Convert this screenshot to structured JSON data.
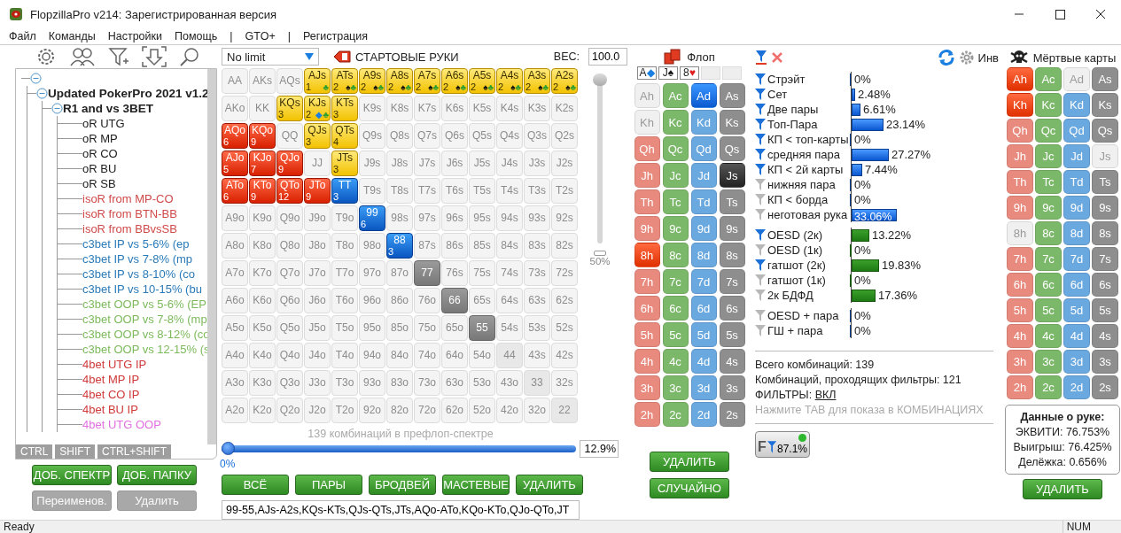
{
  "window": {
    "title": "FlopzillaPro v214: Зарегистрированная версия"
  },
  "menu": [
    "Файл",
    "Команды",
    "Настройки",
    "Помощь",
    "|",
    "GTO+",
    "|",
    "Регистрация"
  ],
  "tree": {
    "expanded": true,
    "children": [
      {
        "label": "Updated PokerPro 2021 v1.2",
        "expanded": true,
        "children": [
          {
            "label": "R1 and vs 3BET",
            "expanded": true,
            "children": [
              {
                "label": "oR UTG",
                "color": "#202020"
              },
              {
                "label": "oR MP",
                "color": "#202020"
              },
              {
                "label": "oR CO",
                "color": "#202020"
              },
              {
                "label": "oR BU",
                "color": "#202020"
              },
              {
                "label": "oR SB",
                "color": "#202020"
              },
              {
                "label": "isoR from MP-CO",
                "color": "#d04a4a"
              },
              {
                "label": "isoR from BTN-BB",
                "color": "#d04a4a"
              },
              {
                "label": "isoR from BBvsSB",
                "color": "#d04a4a"
              },
              {
                "label": "c3bet IP vs 5-6% (ep",
                "color": "#2a7ab8"
              },
              {
                "label": "c3bet IP vs 7-8% (mp",
                "color": "#2a7ab8"
              },
              {
                "label": "c3bet IP vs 8-10% (co",
                "color": "#2a7ab8"
              },
              {
                "label": "c3bet IP vs 10-15% (bu",
                "color": "#2a7ab8"
              },
              {
                "label": "c3bet OOP vs 5-6% (EP",
                "color": "#7cba5c"
              },
              {
                "label": "c3bet OOP vs 7-8% (mp",
                "color": "#7cba5c"
              },
              {
                "label": "c3bet OOP vs 8-12% (co",
                "color": "#7cba5c"
              },
              {
                "label": "c3bet OOP vs 12-15% (s",
                "color": "#7cba5c"
              },
              {
                "label": "4bet UTG IP",
                "color": "#d03a3a"
              },
              {
                "label": "4bet MP IP",
                "color": "#d03a3a"
              },
              {
                "label": "4bet CO IP",
                "color": "#d03a3a"
              },
              {
                "label": "4bet BU IP",
                "color": "#d03a3a"
              },
              {
                "label": "4bet UTG OOP",
                "color": "#e070e0"
              }
            ]
          }
        ]
      }
    ]
  },
  "modifier_keys": [
    "CTRL",
    "SHIFT",
    "CTRL+SHIFT"
  ],
  "left_buttons": [
    {
      "label": "ДОБ. СПЕКТР",
      "disabled": false
    },
    {
      "label": "ДОБ. ПАПКУ",
      "disabled": false
    },
    {
      "label": "Переименов.",
      "disabled": true
    },
    {
      "label": "Удалить",
      "disabled": true
    }
  ],
  "range": {
    "game_type": "No limit",
    "title": "СТАРТОВЫЕ РУКИ",
    "weight_label": "ВЕС:",
    "weight": "100.0",
    "matrix": [
      [
        {
          "label": "AA",
          "kind": "empty"
        },
        {
          "label": "AKs",
          "kind": "empty"
        },
        {
          "label": "AQs",
          "kind": "empty"
        },
        {
          "label": "AJs",
          "kind": "suited",
          "count": "1",
          "suits": [
            {
              "symbol": "♣",
              "color": "#2e9e2e"
            }
          ]
        },
        {
          "label": "ATs",
          "kind": "suited",
          "count": "2",
          "suits": [
            {
              "symbol": "♠",
              "color": "#111111"
            },
            {
              "symbol": "♣",
              "color": "#2e9e2e"
            }
          ]
        },
        {
          "label": "A9s",
          "kind": "suited",
          "count": "2",
          "suits": [
            {
              "symbol": "♠",
              "color": "#111111"
            },
            {
              "symbol": "♣",
              "color": "#2e9e2e"
            }
          ]
        },
        {
          "label": "A8s",
          "kind": "suited",
          "count": "2",
          "suits": [
            {
              "symbol": "♠",
              "color": "#111111"
            },
            {
              "symbol": "♣",
              "color": "#2e9e2e"
            }
          ]
        },
        {
          "label": "A7s",
          "kind": "suited",
          "count": "2",
          "suits": [
            {
              "symbol": "♠",
              "color": "#111111"
            },
            {
              "symbol": "♣",
              "color": "#2e9e2e"
            }
          ]
        },
        {
          "label": "A6s",
          "kind": "suited",
          "count": "2",
          "suits": [
            {
              "symbol": "♠",
              "color": "#111111"
            },
            {
              "symbol": "♣",
              "color": "#2e9e2e"
            }
          ]
        },
        {
          "label": "A5s",
          "kind": "suited",
          "count": "2",
          "suits": [
            {
              "symbol": "♠",
              "color": "#111111"
            },
            {
              "symbol": "♣",
              "color": "#2e9e2e"
            }
          ]
        },
        {
          "label": "A4s",
          "kind": "suited",
          "count": "2",
          "suits": [
            {
              "symbol": "♠",
              "color": "#111111"
            },
            {
              "symbol": "♣",
              "color": "#2e9e2e"
            }
          ]
        },
        {
          "label": "A3s",
          "kind": "suited",
          "count": "2",
          "suits": [
            {
              "symbol": "♠",
              "color": "#111111"
            },
            {
              "symbol": "♣",
              "color": "#2e9e2e"
            }
          ]
        },
        {
          "label": "A2s",
          "kind": "suited",
          "count": "2",
          "suits": [
            {
              "symbol": "♠",
              "color": "#111111"
            },
            {
              "symbol": "♣",
              "color": "#2e9e2e"
            }
          ]
        }
      ],
      [
        {
          "label": "AKo",
          "kind": "empty"
        },
        {
          "label": "KK",
          "kind": "empty"
        },
        {
          "label": "KQs",
          "kind": "suited",
          "count": "3"
        },
        {
          "label": "KJs",
          "kind": "suited",
          "count": "2",
          "suits": [
            {
              "symbol": "◆",
              "color": "#1a7fe0"
            },
            {
              "symbol": "♣",
              "color": "#2e9e2e"
            }
          ]
        },
        {
          "label": "KTs",
          "kind": "suited",
          "count": "3"
        },
        {
          "label": "K9s",
          "kind": "empty"
        },
        {
          "label": "K8s",
          "kind": "empty"
        },
        {
          "label": "K7s",
          "kind": "empty"
        },
        {
          "label": "K6s",
          "kind": "empty"
        },
        {
          "label": "K5s",
          "kind": "empty"
        },
        {
          "label": "K4s",
          "kind": "empty"
        },
        {
          "label": "K3s",
          "kind": "empty"
        },
        {
          "label": "K2s",
          "kind": "empty"
        }
      ],
      [
        {
          "label": "AQo",
          "kind": "offsuit",
          "count": "6"
        },
        {
          "label": "KQo",
          "kind": "offsuit",
          "count": "9"
        },
        {
          "label": "QQ",
          "kind": "empty"
        },
        {
          "label": "QJs",
          "kind": "suited",
          "count": "3"
        },
        {
          "label": "QTs",
          "kind": "suited",
          "count": "4"
        },
        {
          "label": "Q9s",
          "kind": "empty"
        },
        {
          "label": "Q8s",
          "kind": "empty"
        },
        {
          "label": "Q7s",
          "kind": "empty"
        },
        {
          "label": "Q6s",
          "kind": "empty"
        },
        {
          "label": "Q5s",
          "kind": "empty"
        },
        {
          "label": "Q4s",
          "kind": "empty"
        },
        {
          "label": "Q3s",
          "kind": "empty"
        },
        {
          "label": "Q2s",
          "kind": "empty"
        }
      ],
      [
        {
          "label": "AJo",
          "kind": "offsuit",
          "count": "5"
        },
        {
          "label": "KJo",
          "kind": "offsuit",
          "count": "7"
        },
        {
          "label": "QJo",
          "kind": "offsuit",
          "count": "9"
        },
        {
          "label": "JJ",
          "kind": "empty"
        },
        {
          "label": "JTs",
          "kind": "suited",
          "count": "3"
        },
        {
          "label": "J9s",
          "kind": "empty"
        },
        {
          "label": "J8s",
          "kind": "empty"
        },
        {
          "label": "J7s",
          "kind": "empty"
        },
        {
          "label": "J6s",
          "kind": "empty"
        },
        {
          "label": "J5s",
          "kind": "empty"
        },
        {
          "label": "J4s",
          "kind": "empty"
        },
        {
          "label": "J3s",
          "kind": "empty"
        },
        {
          "label": "J2s",
          "kind": "empty"
        }
      ],
      [
        {
          "label": "ATo",
          "kind": "offsuit",
          "count": "6"
        },
        {
          "label": "KTo",
          "kind": "offsuit",
          "count": "9"
        },
        {
          "label": "QTo",
          "kind": "offsuit",
          "count": "12"
        },
        {
          "label": "JTo",
          "kind": "offsuit",
          "count": "9"
        },
        {
          "label": "TT",
          "kind": "pair",
          "count": "3"
        },
        {
          "label": "T9s",
          "kind": "empty"
        },
        {
          "label": "T8s",
          "kind": "empty"
        },
        {
          "label": "T7s",
          "kind": "empty"
        },
        {
          "label": "T6s",
          "kind": "empty"
        },
        {
          "label": "T5s",
          "kind": "empty"
        },
        {
          "label": "T4s",
          "kind": "empty"
        },
        {
          "label": "T3s",
          "kind": "empty"
        },
        {
          "label": "T2s",
          "kind": "empty"
        }
      ],
      [
        {
          "label": "A9o",
          "kind": "empty"
        },
        {
          "label": "K9o",
          "kind": "empty"
        },
        {
          "label": "Q9o",
          "kind": "empty"
        },
        {
          "label": "J9o",
          "kind": "empty"
        },
        {
          "label": "T9o",
          "kind": "empty"
        },
        {
          "label": "99",
          "kind": "pair",
          "count": "6"
        },
        {
          "label": "98s",
          "kind": "empty"
        },
        {
          "label": "97s",
          "kind": "empty"
        },
        {
          "label": "96s",
          "kind": "empty"
        },
        {
          "label": "95s",
          "kind": "empty"
        },
        {
          "label": "94s",
          "kind": "empty"
        },
        {
          "label": "93s",
          "kind": "empty"
        },
        {
          "label": "92s",
          "kind": "empty"
        }
      ],
      [
        {
          "label": "A8o",
          "kind": "empty"
        },
        {
          "label": "K8o",
          "kind": "empty"
        },
        {
          "label": "Q8o",
          "kind": "empty"
        },
        {
          "label": "J8o",
          "kind": "empty"
        },
        {
          "label": "T8o",
          "kind": "empty"
        },
        {
          "label": "98o",
          "kind": "empty"
        },
        {
          "label": "88",
          "kind": "pair",
          "count": "3"
        },
        {
          "label": "87s",
          "kind": "empty"
        },
        {
          "label": "86s",
          "kind": "empty"
        },
        {
          "label": "85s",
          "kind": "empty"
        },
        {
          "label": "84s",
          "kind": "empty"
        },
        {
          "label": "83s",
          "kind": "empty"
        },
        {
          "label": "82s",
          "kind": "empty"
        }
      ],
      [
        {
          "label": "A7o",
          "kind": "empty"
        },
        {
          "label": "K7o",
          "kind": "empty"
        },
        {
          "label": "Q7o",
          "kind": "empty"
        },
        {
          "label": "J7o",
          "kind": "empty"
        },
        {
          "label": "T7o",
          "kind": "empty"
        },
        {
          "label": "97o",
          "kind": "empty"
        },
        {
          "label": "87o",
          "kind": "empty"
        },
        {
          "label": "77",
          "kind": "greyed"
        },
        {
          "label": "76s",
          "kind": "empty"
        },
        {
          "label": "75s",
          "kind": "empty"
        },
        {
          "label": "74s",
          "kind": "empty"
        },
        {
          "label": "73s",
          "kind": "empty"
        },
        {
          "label": "72s",
          "kind": "empty"
        }
      ],
      [
        {
          "label": "A6o",
          "kind": "empty"
        },
        {
          "label": "K6o",
          "kind": "empty"
        },
        {
          "label": "Q6o",
          "kind": "empty"
        },
        {
          "label": "J6o",
          "kind": "empty"
        },
        {
          "label": "T6o",
          "kind": "empty"
        },
        {
          "label": "96o",
          "kind": "empty"
        },
        {
          "label": "86o",
          "kind": "empty"
        },
        {
          "label": "76o",
          "kind": "empty"
        },
        {
          "label": "66",
          "kind": "greyed"
        },
        {
          "label": "65s",
          "kind": "empty"
        },
        {
          "label": "64s",
          "kind": "empty"
        },
        {
          "label": "63s",
          "kind": "empty"
        },
        {
          "label": "62s",
          "kind": "empty"
        }
      ],
      [
        {
          "label": "A5o",
          "kind": "empty"
        },
        {
          "label": "K5o",
          "kind": "empty"
        },
        {
          "label": "Q5o",
          "kind": "empty"
        },
        {
          "label": "J5o",
          "kind": "empty"
        },
        {
          "label": "T5o",
          "kind": "empty"
        },
        {
          "label": "95o",
          "kind": "empty"
        },
        {
          "label": "85o",
          "kind": "empty"
        },
        {
          "label": "75o",
          "kind": "empty"
        },
        {
          "label": "65o",
          "kind": "empty"
        },
        {
          "label": "55",
          "kind": "greyed"
        },
        {
          "label": "54s",
          "kind": "empty"
        },
        {
          "label": "53s",
          "kind": "empty"
        },
        {
          "label": "52s",
          "kind": "empty"
        }
      ],
      [
        {
          "label": "A4o",
          "kind": "empty"
        },
        {
          "label": "K4o",
          "kind": "empty"
        },
        {
          "label": "Q4o",
          "kind": "empty"
        },
        {
          "label": "J4o",
          "kind": "empty"
        },
        {
          "label": "T4o",
          "kind": "empty"
        },
        {
          "label": "94o",
          "kind": "empty"
        },
        {
          "label": "84o",
          "kind": "empty"
        },
        {
          "label": "74o",
          "kind": "empty"
        },
        {
          "label": "64o",
          "kind": "empty"
        },
        {
          "label": "54o",
          "kind": "empty"
        },
        {
          "label": "44",
          "kind": "faded"
        },
        {
          "label": "43s",
          "kind": "empty"
        },
        {
          "label": "42s",
          "kind": "empty"
        }
      ],
      [
        {
          "label": "A3o",
          "kind": "empty"
        },
        {
          "label": "K3o",
          "kind": "empty"
        },
        {
          "label": "Q3o",
          "kind": "empty"
        },
        {
          "label": "J3o",
          "kind": "empty"
        },
        {
          "label": "T3o",
          "kind": "empty"
        },
        {
          "label": "93o",
          "kind": "empty"
        },
        {
          "label": "83o",
          "kind": "empty"
        },
        {
          "label": "73o",
          "kind": "empty"
        },
        {
          "label": "63o",
          "kind": "empty"
        },
        {
          "label": "53o",
          "kind": "empty"
        },
        {
          "label": "43o",
          "kind": "empty"
        },
        {
          "label": "33",
          "kind": "faded"
        },
        {
          "label": "32s",
          "kind": "empty"
        }
      ],
      [
        {
          "label": "A2o",
          "kind": "empty"
        },
        {
          "label": "K2o",
          "kind": "empty"
        },
        {
          "label": "Q2o",
          "kind": "empty"
        },
        {
          "label": "J2o",
          "kind": "empty"
        },
        {
          "label": "T2o",
          "kind": "empty"
        },
        {
          "label": "92o",
          "kind": "empty"
        },
        {
          "label": "82o",
          "kind": "empty"
        },
        {
          "label": "72o",
          "kind": "empty"
        },
        {
          "label": "62o",
          "kind": "empty"
        },
        {
          "label": "52o",
          "kind": "empty"
        },
        {
          "label": "42o",
          "kind": "empty"
        },
        {
          "label": "32o",
          "kind": "empty"
        },
        {
          "label": "22",
          "kind": "faded"
        }
      ]
    ],
    "zoom_slider": {
      "level": 1
    },
    "zoom_reading": "50%",
    "combos_text": "139 комбинаций в префлоп-спектре",
    "percent_slider": {
      "level": 0
    },
    "slider_min": "0%",
    "percent": "12.9%",
    "buttons": [
      "ВСЁ",
      "ПАРЫ",
      "БРОДВЕЙ",
      "МАСТЕВЫЕ",
      "УДАЛИТЬ"
    ],
    "range_text": "99-55,AJs-A2s,KQs-KTs,QJs-QTs,JTs,AQo-ATo,KQo-KTo,QJo-QTo,JT"
  },
  "flop": {
    "title": "Флоп",
    "board": [
      {
        "kind": "card",
        "rank": "A",
        "suit": "◆",
        "color": "#1a7fe0"
      },
      {
        "kind": "card",
        "rank": "J",
        "suit": "♠",
        "color": "#111111"
      },
      {
        "kind": "card",
        "rank": "8",
        "suit": "♥",
        "color": "#e02020"
      },
      {
        "kind": "empty"
      },
      {
        "kind": "empty"
      }
    ],
    "cards": [
      [
        {
          "label": "Ah",
          "kind": "heart",
          "selected": false,
          "disabled": true
        },
        {
          "label": "Ac",
          "kind": "club",
          "selected": false,
          "disabled": false
        },
        {
          "label": "Ad",
          "kind": "diamond",
          "selected": true,
          "disabled": false
        },
        {
          "label": "As",
          "kind": "spade",
          "selected": false,
          "disabled": false
        }
      ],
      [
        {
          "label": "Kh",
          "kind": "heart",
          "selected": false,
          "disabled": true
        },
        {
          "label": "Kc",
          "kind": "club",
          "selected": false,
          "disabled": false
        },
        {
          "label": "Kd",
          "kind": "diamond",
          "selected": false,
          "disabled": false
        },
        {
          "label": "Ks",
          "kind": "spade",
          "selected": false,
          "disabled": false
        }
      ],
      [
        {
          "label": "Qh",
          "kind": "heart",
          "selected": false,
          "disabled": false
        },
        {
          "label": "Qc",
          "kind": "club",
          "selected": false,
          "disabled": false
        },
        {
          "label": "Qd",
          "kind": "diamond",
          "selected": false,
          "disabled": false
        },
        {
          "label": "Qs",
          "kind": "spade",
          "selected": false,
          "disabled": false
        }
      ],
      [
        {
          "label": "Jh",
          "kind": "heart",
          "selected": false,
          "disabled": false
        },
        {
          "label": "Jc",
          "kind": "club",
          "selected": false,
          "disabled": false
        },
        {
          "label": "Jd",
          "kind": "diamond",
          "selected": false,
          "disabled": false
        },
        {
          "label": "Js",
          "kind": "spade",
          "selected": true,
          "disabled": false
        }
      ],
      [
        {
          "label": "Th",
          "kind": "heart",
          "selected": false,
          "disabled": false
        },
        {
          "label": "Tc",
          "kind": "club",
          "selected": false,
          "disabled": false
        },
        {
          "label": "Td",
          "kind": "diamond",
          "selected": false,
          "disabled": false
        },
        {
          "label": "Ts",
          "kind": "spade",
          "selected": false,
          "disabled": false
        }
      ],
      [
        {
          "label": "9h",
          "kind": "heart",
          "selected": false,
          "disabled": false
        },
        {
          "label": "9c",
          "kind": "club",
          "selected": false,
          "disabled": false
        },
        {
          "label": "9d",
          "kind": "diamond",
          "selected": false,
          "disabled": false
        },
        {
          "label": "9s",
          "kind": "spade",
          "selected": false,
          "disabled": false
        }
      ],
      [
        {
          "label": "8h",
          "kind": "heart",
          "selected": true,
          "disabled": false
        },
        {
          "label": "8c",
          "kind": "club",
          "selected": false,
          "disabled": false
        },
        {
          "label": "8d",
          "kind": "diamond",
          "selected": false,
          "disabled": false
        },
        {
          "label": "8s",
          "kind": "spade",
          "selected": false,
          "disabled": false
        }
      ],
      [
        {
          "label": "7h",
          "kind": "heart",
          "selected": false,
          "disabled": false
        },
        {
          "label": "7c",
          "kind": "club",
          "selected": false,
          "disabled": false
        },
        {
          "label": "7d",
          "kind": "diamond",
          "selected": false,
          "disabled": false
        },
        {
          "label": "7s",
          "kind": "spade",
          "selected": false,
          "disabled": false
        }
      ],
      [
        {
          "label": "6h",
          "kind": "heart",
          "selected": false,
          "disabled": false
        },
        {
          "label": "6c",
          "kind": "club",
          "selected": false,
          "disabled": false
        },
        {
          "label": "6d",
          "kind": "diamond",
          "selected": false,
          "disabled": false
        },
        {
          "label": "6s",
          "kind": "spade",
          "selected": false,
          "disabled": false
        }
      ],
      [
        {
          "label": "5h",
          "kind": "heart",
          "selected": false,
          "disabled": false
        },
        {
          "label": "5c",
          "kind": "club",
          "selected": false,
          "disabled": false
        },
        {
          "label": "5d",
          "kind": "diamond",
          "selected": false,
          "disabled": false
        },
        {
          "label": "5s",
          "kind": "spade",
          "selected": false,
          "disabled": false
        }
      ],
      [
        {
          "label": "4h",
          "kind": "heart",
          "selected": false,
          "disabled": false
        },
        {
          "label": "4c",
          "kind": "club",
          "selected": false,
          "disabled": false
        },
        {
          "label": "4d",
          "kind": "diamond",
          "selected": false,
          "disabled": false
        },
        {
          "label": "4s",
          "kind": "spade",
          "selected": false,
          "disabled": false
        }
      ],
      [
        {
          "label": "3h",
          "kind": "heart",
          "selected": false,
          "disabled": false
        },
        {
          "label": "3c",
          "kind": "club",
          "selected": false,
          "disabled": false
        },
        {
          "label": "3d",
          "kind": "diamond",
          "selected": false,
          "disabled": false
        },
        {
          "label": "3s",
          "kind": "spade",
          "selected": false,
          "disabled": false
        }
      ],
      [
        {
          "label": "2h",
          "kind": "heart",
          "selected": false,
          "disabled": false
        },
        {
          "label": "2c",
          "kind": "club",
          "selected": false,
          "disabled": false
        },
        {
          "label": "2d",
          "kind": "diamond",
          "selected": false,
          "disabled": false
        },
        {
          "label": "2s",
          "kind": "spade",
          "selected": false,
          "disabled": false
        }
      ]
    ],
    "buttons": [
      "УДАЛИТЬ",
      "СЛУЧАЙНО"
    ]
  },
  "filters": {
    "inv_label": "Инв",
    "groups": [
      {
        "kind": "made",
        "items": [
          {
            "label": "Стрэйт",
            "active": true,
            "value": "0%",
            "level": 0,
            "selected": false
          },
          {
            "label": "Сет",
            "active": true,
            "value": "2.48%",
            "level": 0.0248,
            "selected": false
          },
          {
            "label": "Две пары",
            "active": true,
            "value": "6.61%",
            "level": 0.0661,
            "selected": false
          },
          {
            "label": "Топ-Пара",
            "active": true,
            "value": "23.14%",
            "level": 0.2314,
            "selected": false
          },
          {
            "label": "КП < топ-карты",
            "active": true,
            "value": "0%",
            "level": 0,
            "selected": false
          },
          {
            "label": "средняя пара",
            "active": true,
            "value": "27.27%",
            "level": 0.2727,
            "selected": false
          },
          {
            "label": "КП < 2й карты",
            "active": true,
            "value": "7.44%",
            "level": 0.0744,
            "selected": false
          },
          {
            "label": "нижняя пара",
            "active": false,
            "value": "0%",
            "level": 0,
            "selected": false
          },
          {
            "label": "КП < борда",
            "active": false,
            "value": "0%",
            "level": 0,
            "selected": false
          },
          {
            "label": "неготовая рука",
            "active": false,
            "value": "33.06%",
            "level": 0.3306,
            "selected": true
          }
        ]
      },
      {
        "kind": "draw",
        "items": [
          {
            "label": "OESD (2к)",
            "active": true,
            "value": "13.22%",
            "level": 0.1322,
            "selected": false
          },
          {
            "label": "OESD (1к)",
            "active": false,
            "value": "0%",
            "level": 0,
            "selected": false
          },
          {
            "label": "гатшот (2к)",
            "active": true,
            "value": "19.83%",
            "level": 0.1983,
            "selected": false
          },
          {
            "label": "гатшот (1к)",
            "active": false,
            "value": "0%",
            "level": 0,
            "selected": false
          },
          {
            "label": "2к БДФД",
            "active": false,
            "value": "17.36%",
            "level": 0.1736,
            "selected": false
          }
        ]
      },
      {
        "items": [
          {
            "label": "OESD + пара",
            "active": false,
            "value": "0%",
            "level": 0,
            "selected": false
          },
          {
            "label": "ГШ + пара",
            "active": false,
            "value": "0%",
            "level": 0,
            "selected": false
          }
        ]
      }
    ],
    "total": "Всего комбинаций: 139",
    "passing": "Комбинаций, проходящих фильтры: 121",
    "filters_label": "ФИЛЬТРЫ:",
    "filters_state": "ВКЛ",
    "hint": "Нажмите TAB для показа в КОМБИНАЦИЯХ",
    "badge": {
      "letter": "F",
      "value": "87.1%",
      "on": true
    }
  },
  "dead": {
    "title": "Мёртвые карты",
    "cards": [
      [
        {
          "label": "Ah",
          "kind": "heart",
          "selected": true,
          "disabled": false
        },
        {
          "label": "Ac",
          "kind": "club",
          "selected": false,
          "disabled": false
        },
        {
          "label": "Ad",
          "kind": "diamond",
          "selected": false,
          "disabled": true
        },
        {
          "label": "As",
          "kind": "spade",
          "selected": false,
          "disabled": false
        }
      ],
      [
        {
          "label": "Kh",
          "kind": "heart",
          "selected": true,
          "disabled": false
        },
        {
          "label": "Kc",
          "kind": "club",
          "selected": false,
          "disabled": false
        },
        {
          "label": "Kd",
          "kind": "diamond",
          "selected": false,
          "disabled": false
        },
        {
          "label": "Ks",
          "kind": "spade",
          "selected": false,
          "disabled": false
        }
      ],
      [
        {
          "label": "Qh",
          "kind": "heart",
          "selected": false,
          "disabled": false
        },
        {
          "label": "Qc",
          "kind": "club",
          "selected": false,
          "disabled": false
        },
        {
          "label": "Qd",
          "kind": "diamond",
          "selected": false,
          "disabled": false
        },
        {
          "label": "Qs",
          "kind": "spade",
          "selected": false,
          "disabled": false
        }
      ],
      [
        {
          "label": "Jh",
          "kind": "heart",
          "selected": false,
          "disabled": false
        },
        {
          "label": "Jc",
          "kind": "club",
          "selected": false,
          "disabled": false
        },
        {
          "label": "Jd",
          "kind": "diamond",
          "selected": false,
          "disabled": false
        },
        {
          "label": "Js",
          "kind": "spade",
          "selected": false,
          "disabled": true
        }
      ],
      [
        {
          "label": "Th",
          "kind": "heart",
          "selected": false,
          "disabled": false
        },
        {
          "label": "Tc",
          "kind": "club",
          "selected": false,
          "disabled": false
        },
        {
          "label": "Td",
          "kind": "diamond",
          "selected": false,
          "disabled": false
        },
        {
          "label": "Ts",
          "kind": "spade",
          "selected": false,
          "disabled": false
        }
      ],
      [
        {
          "label": "9h",
          "kind": "heart",
          "selected": false,
          "disabled": false
        },
        {
          "label": "9c",
          "kind": "club",
          "selected": false,
          "disabled": false
        },
        {
          "label": "9d",
          "kind": "diamond",
          "selected": false,
          "disabled": false
        },
        {
          "label": "9s",
          "kind": "spade",
          "selected": false,
          "disabled": false
        }
      ],
      [
        {
          "label": "8h",
          "kind": "heart",
          "selected": false,
          "disabled": true
        },
        {
          "label": "8c",
          "kind": "club",
          "selected": false,
          "disabled": false
        },
        {
          "label": "8d",
          "kind": "diamond",
          "selected": false,
          "disabled": false
        },
        {
          "label": "8s",
          "kind": "spade",
          "selected": false,
          "disabled": false
        }
      ],
      [
        {
          "label": "7h",
          "kind": "heart",
          "selected": false,
          "disabled": false
        },
        {
          "label": "7c",
          "kind": "club",
          "selected": false,
          "disabled": false
        },
        {
          "label": "7d",
          "kind": "diamond",
          "selected": false,
          "disabled": false
        },
        {
          "label": "7s",
          "kind": "spade",
          "selected": false,
          "disabled": false
        }
      ],
      [
        {
          "label": "6h",
          "kind": "heart",
          "selected": false,
          "disabled": false
        },
        {
          "label": "6c",
          "kind": "club",
          "selected": false,
          "disabled": false
        },
        {
          "label": "6d",
          "kind": "diamond",
          "selected": false,
          "disabled": false
        },
        {
          "label": "6s",
          "kind": "spade",
          "selected": false,
          "disabled": false
        }
      ],
      [
        {
          "label": "5h",
          "kind": "heart",
          "selected": false,
          "disabled": false
        },
        {
          "label": "5c",
          "kind": "club",
          "selected": false,
          "disabled": false
        },
        {
          "label": "5d",
          "kind": "diamond",
          "selected": false,
          "disabled": false
        },
        {
          "label": "5s",
          "kind": "spade",
          "selected": false,
          "disabled": false
        }
      ],
      [
        {
          "label": "4h",
          "kind": "heart",
          "selected": false,
          "disabled": false
        },
        {
          "label": "4c",
          "kind": "club",
          "selected": false,
          "disabled": false
        },
        {
          "label": "4d",
          "kind": "diamond",
          "selected": false,
          "disabled": false
        },
        {
          "label": "4s",
          "kind": "spade",
          "selected": false,
          "disabled": false
        }
      ],
      [
        {
          "label": "3h",
          "kind": "heart",
          "selected": false,
          "disabled": false
        },
        {
          "label": "3c",
          "kind": "club",
          "selected": false,
          "disabled": false
        },
        {
          "label": "3d",
          "kind": "diamond",
          "selected": false,
          "disabled": false
        },
        {
          "label": "3s",
          "kind": "spade",
          "selected": false,
          "disabled": false
        }
      ],
      [
        {
          "label": "2h",
          "kind": "heart",
          "selected": false,
          "disabled": false
        },
        {
          "label": "2c",
          "kind": "club",
          "selected": false,
          "disabled": false
        },
        {
          "label": "2d",
          "kind": "diamond",
          "selected": false,
          "disabled": false
        },
        {
          "label": "2s",
          "kind": "spade",
          "selected": false,
          "disabled": false
        }
      ]
    ],
    "hand_info": {
      "title": "Данные о руке:",
      "lines": [
        "ЭКВИТИ: 76.753%",
        "Выигрыш: 76.425%",
        "Делёжка: 0.656%"
      ]
    },
    "button": "УДАЛИТЬ"
  },
  "status_bar": {
    "text": "Ready",
    "num": "NUM"
  }
}
